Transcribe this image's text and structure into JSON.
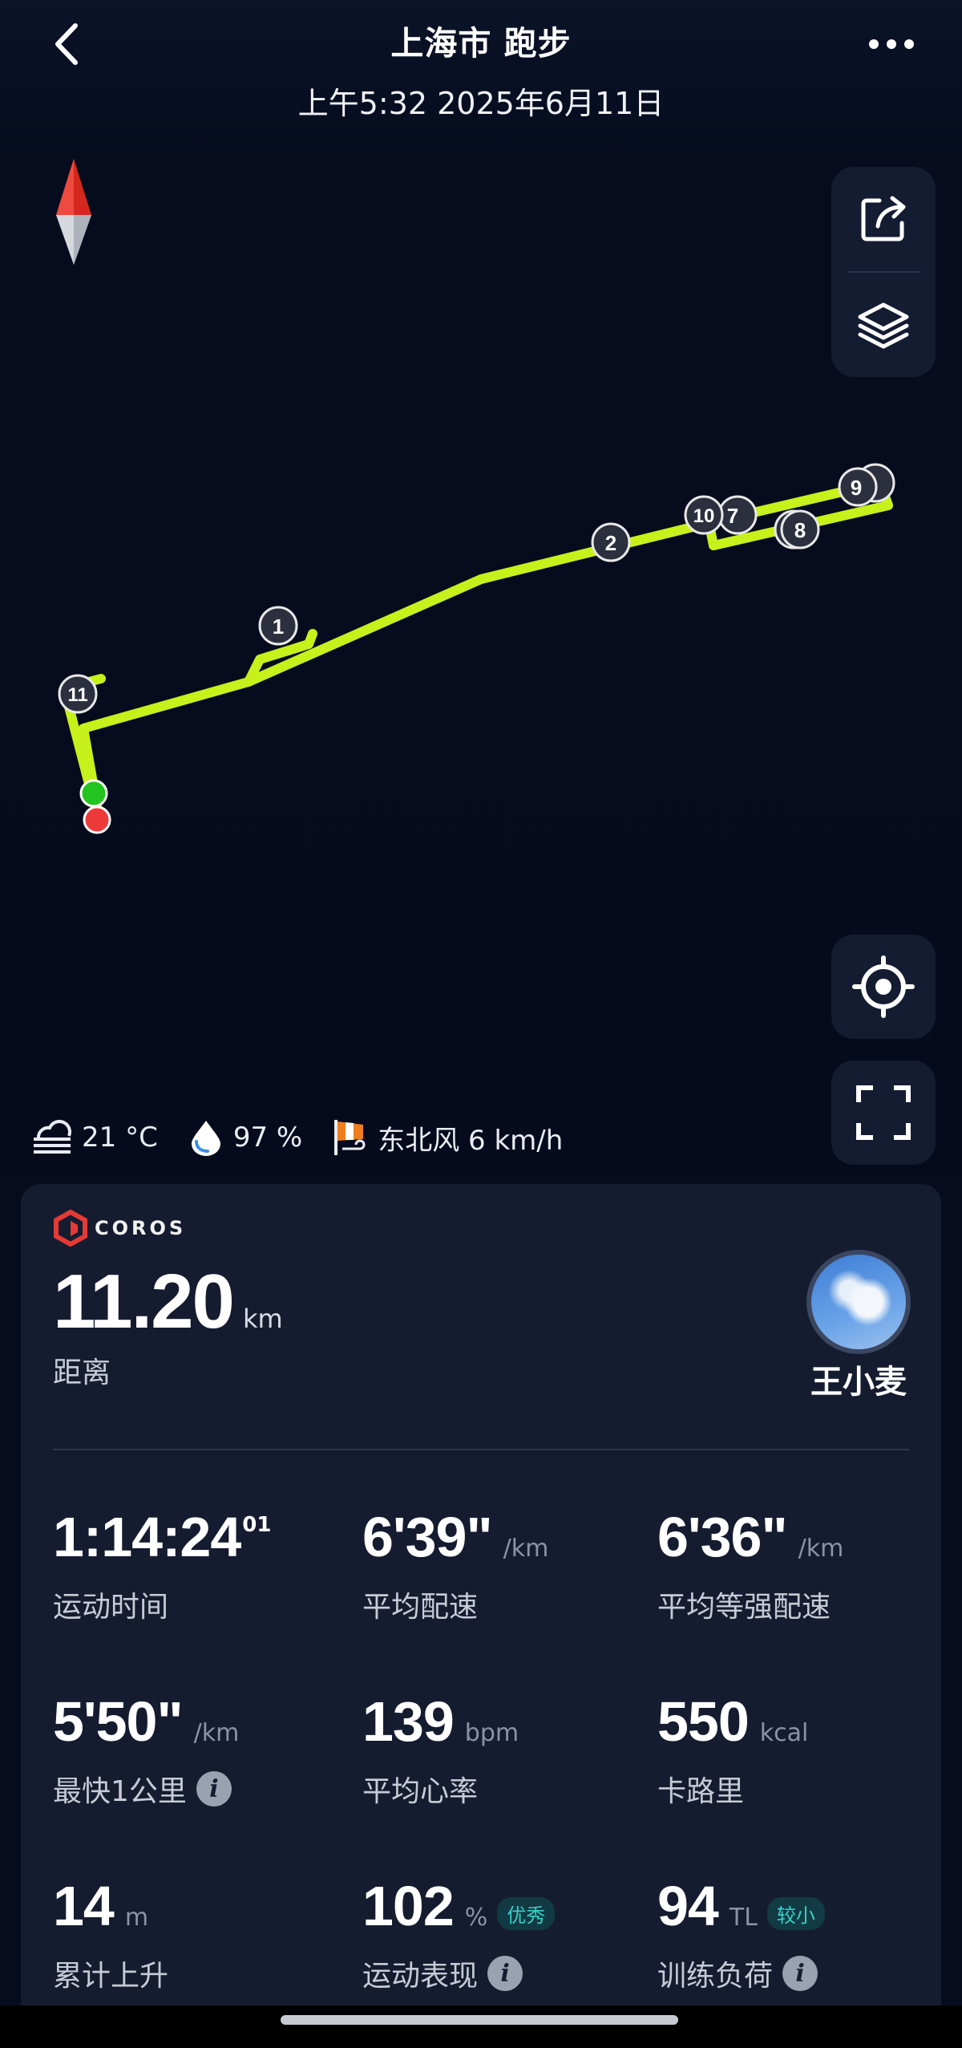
{
  "header": {
    "title": "上海市 跑步",
    "subtitle": "上午5:32 2025年6月11日"
  },
  "map": {
    "route_color": "#c8f01a",
    "start_color": "#22c51f",
    "end_color": "#ec3a3a",
    "km_markers": [
      "1",
      "2",
      "7",
      "8",
      "9",
      "10",
      "11"
    ]
  },
  "weather": {
    "temperature": "21 °C",
    "humidity": "97  %",
    "wind": "东北风 6 km/h"
  },
  "card": {
    "brand": "COROS",
    "distance_value": "11.20",
    "distance_unit": "km",
    "distance_label": "距离",
    "username": "王小麦",
    "stats": {
      "time": {
        "value": "1:14:24",
        "sup": "01",
        "label": "运动时间"
      },
      "avg_pace": {
        "value": "6'39\"",
        "unit": "/km",
        "label": "平均配速"
      },
      "grade_pace": {
        "value": "6'36\"",
        "unit": "/km",
        "label": "平均等强配速"
      },
      "fastest_km": {
        "value": "5'50\"",
        "unit": "/km",
        "label": "最快1公里"
      },
      "avg_hr": {
        "value": "139",
        "unit": "bpm",
        "label": "平均心率"
      },
      "calories": {
        "value": "550",
        "unit": "kcal",
        "label": "卡路里"
      },
      "ascent": {
        "value": "14",
        "unit": "m",
        "label": "累计上升"
      },
      "performance": {
        "value": "102",
        "unit": "%",
        "badge": "优秀",
        "label": "运动表现"
      },
      "training_load": {
        "value": "94",
        "unit": "TL",
        "badge": "较小",
        "label": "训练负荷"
      }
    }
  }
}
